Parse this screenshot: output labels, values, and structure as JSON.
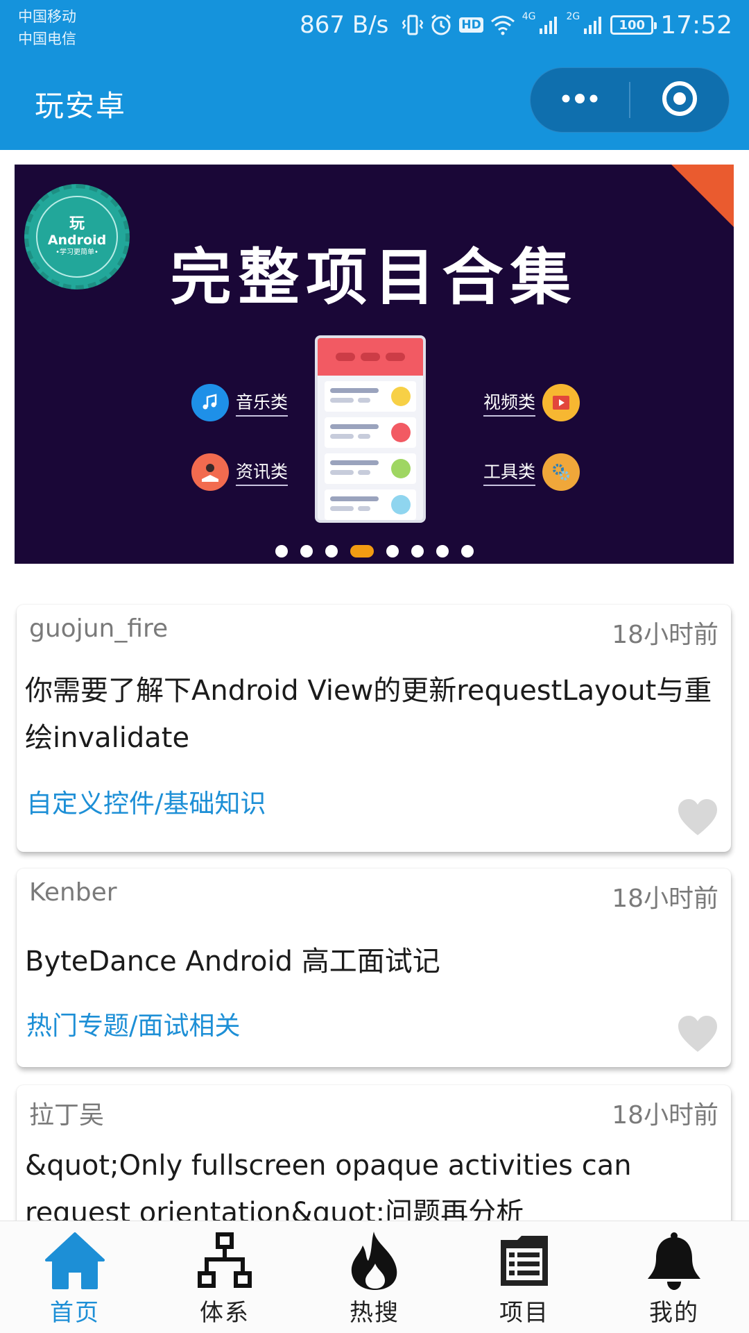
{
  "status_bar": {
    "carrier_1": "中国移动",
    "carrier_2": "中国电信",
    "net_speed": "867 B/s",
    "hd_label": "HD",
    "net_1": "4G",
    "net_2": "2G",
    "battery": "100",
    "time": "17:52"
  },
  "header": {
    "title": "玩安卓",
    "more_icon": "more-dots-icon",
    "close_icon": "target-circle-icon"
  },
  "banner": {
    "badge_top": "玩",
    "badge_mid": "Android",
    "badge_bottom": "•学习更简单•",
    "title": "完整项目合集",
    "categories": [
      {
        "label": "音乐类",
        "icon": "music-note-icon",
        "color": "#1e90e8"
      },
      {
        "label": "视频类",
        "icon": "video-play-icon",
        "color": "#f7b731"
      },
      {
        "label": "资讯类",
        "icon": "reading-person-icon",
        "color": "#f26b4f"
      },
      {
        "label": "工具类",
        "icon": "gears-icon",
        "color": "#f0a73a"
      }
    ],
    "page_count": 8,
    "active_page": 4,
    "colors": {
      "background": "#1a0737",
      "corner": "#ea5b2f",
      "active_dot": "#f39c12"
    }
  },
  "articles": [
    {
      "author": "guojun_fire",
      "time": "18小时前",
      "title": "你需要了解下Android View的更新requestLayout与重绘invalidate",
      "chapter": "自定义控件/基础知识",
      "liked": false
    },
    {
      "author": "Kenber",
      "time": "18小时前",
      "title": "ByteDance Android 高工面试记",
      "chapter": "热门专题/面试相关",
      "liked": false
    },
    {
      "author": "拉丁吴",
      "time": "18小时前",
      "title": "&quot;Only fullscreen opaque activities can request orientation&quot;问题再分析",
      "chapter": "",
      "liked": false
    }
  ],
  "tabs": [
    {
      "label": "首页",
      "icon": "home-icon",
      "active": true
    },
    {
      "label": "体系",
      "icon": "hierarchy-icon",
      "active": false
    },
    {
      "label": "热搜",
      "icon": "flame-icon",
      "active": false
    },
    {
      "label": "项目",
      "icon": "list-board-icon",
      "active": false
    },
    {
      "label": "我的",
      "icon": "bell-icon",
      "active": false
    }
  ],
  "colors": {
    "primary": "#1593dc",
    "accent_text": "#1d8fd6",
    "heart": "#d8d8d8"
  }
}
